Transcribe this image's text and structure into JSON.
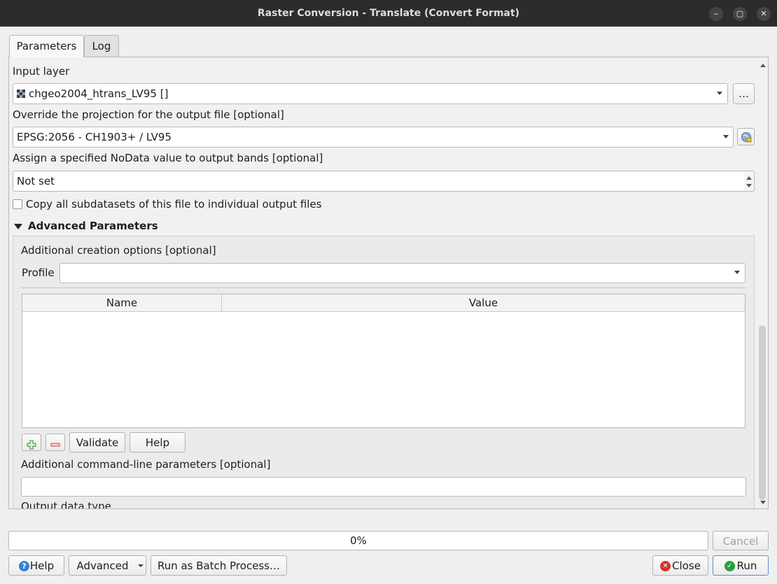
{
  "window": {
    "title": "Raster Conversion - Translate (Convert Format)",
    "minimize": "‒",
    "maximize": "▢",
    "close": "✕"
  },
  "tabs": [
    {
      "label": "Parameters",
      "active": true
    },
    {
      "label": "Log",
      "active": false
    }
  ],
  "params": {
    "input_layer_label": "Input layer",
    "input_layer_value": "chgeo2004_htrans_LV95 []",
    "browse_label": "…",
    "projection_label": "Override the projection for the output file [optional]",
    "projection_value": "EPSG:2056 - CH1903+ / LV95",
    "nodata_label": "Assign a specified NoData value to output bands [optional]",
    "nodata_value": "Not set",
    "copy_subdatasets_label": "Copy all subdatasets of this file to individual output files",
    "copy_subdatasets_checked": false
  },
  "advanced": {
    "header": "Advanced Parameters",
    "creation_options_label": "Additional creation options [optional]",
    "profile_label": "Profile",
    "profile_value": "",
    "table_headers": [
      "Name",
      "Value"
    ],
    "table_rows": [],
    "validate_label": "Validate",
    "help_label": "Help",
    "cmdline_label": "Additional command-line parameters [optional]",
    "cmdline_value": "",
    "output_type_label": "Output data type"
  },
  "footer": {
    "progress_text": "0%",
    "progress_value": 0,
    "cancel_label": "Cancel",
    "help_label": "Help",
    "advanced_label": "Advanced",
    "batch_label": "Run as Batch Process…",
    "close_label": "Close",
    "run_label": "Run"
  },
  "colors": {
    "titlebar": "#2c2c2c",
    "add_icon": "#2e8b2e",
    "remove_icon": "#d33c3c",
    "run_icon": "#22a03a",
    "close_icon": "#d9302c",
    "help_icon": "#3b7fd1"
  }
}
